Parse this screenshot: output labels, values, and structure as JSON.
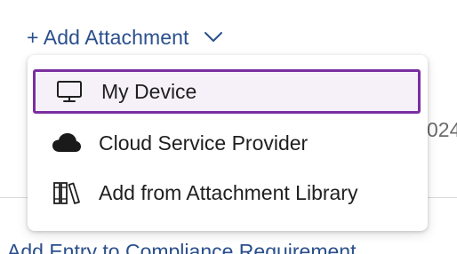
{
  "header": {
    "add_attachment_label": "+ Add Attachment",
    "dropdown_icon": "chevron-down-icon"
  },
  "menu": {
    "items": [
      {
        "label": "My Device",
        "icon": "monitor-icon",
        "selected": true
      },
      {
        "label": "Cloud Service Provider",
        "icon": "cloud-icon",
        "selected": false
      },
      {
        "label": "Add from Attachment Library",
        "icon": "library-icon",
        "selected": false
      }
    ]
  },
  "background": {
    "partial_right_text": "024",
    "partial_bottom_link": "Add Entry to Compliance Requirement"
  },
  "colors": {
    "link": "#2a4f8c",
    "selection_border": "#7a2fa0",
    "menu_text": "#1f1f1f"
  }
}
